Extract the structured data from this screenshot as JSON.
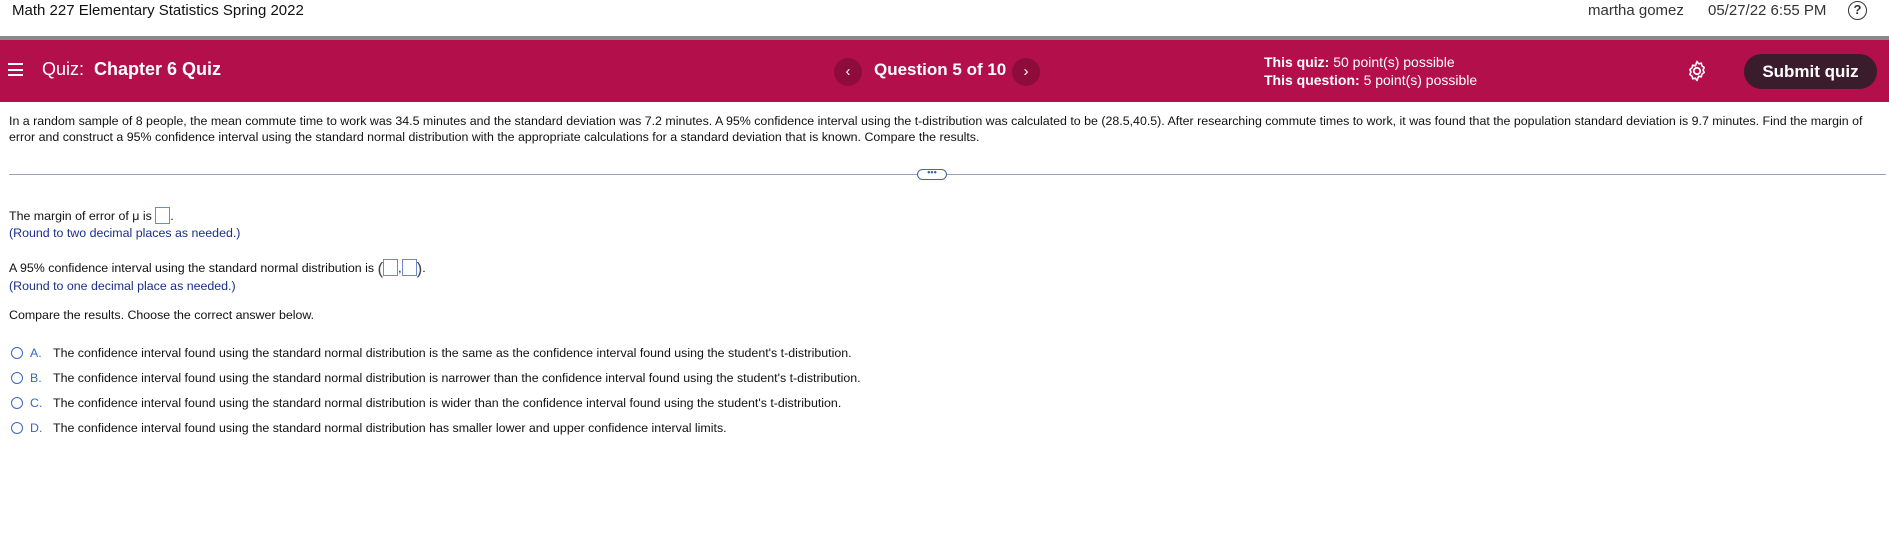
{
  "topbar": {
    "course_title": "Math 227 Elementary Statistics Spring 2022",
    "user_name": "martha gomez",
    "datetime": "05/27/22 6:55 PM",
    "help_symbol": "?"
  },
  "quizbar": {
    "quiz_label": "Quiz:",
    "quiz_name": "Chapter 6 Quiz",
    "question_label": "Question 5 of 10",
    "prev_symbol": "‹",
    "next_symbol": "›",
    "this_quiz_label": "This quiz:",
    "this_quiz_value": "50 point(s) possible",
    "this_question_label": "This question:",
    "this_question_value": "5 point(s) possible",
    "submit_label": "Submit quiz",
    "bg_color": "#b30f4a"
  },
  "question": {
    "problem_text": "In a random sample of 8 people, the mean commute time to work was 34.5 minutes and the standard deviation was 7.2 minutes. A 95% confidence interval using the t-distribution was calculated to be (28.5,40.5). After researching commute times to work, it was found that the population standard deviation is 9.7 minutes. Find the margin of error and construct a 95% confidence interval using the standard normal distribution with the appropriate calculations for a standard deviation that is known. Compare the results.",
    "expand_symbol": "•••",
    "margin_prompt": "The margin of error of μ is",
    "margin_value": "",
    "margin_hint": "(Round to two decimal places as needed.)",
    "ci_prompt": "A 95% confidence interval using the standard normal distribution is",
    "ci_lower": "",
    "ci_upper": "",
    "ci_hint": "(Round to one decimal place as needed.)",
    "compare_prompt": "Compare the results. Choose the correct answer below.",
    "options": [
      {
        "letter": "A.",
        "text": "The confidence interval found using the standard normal distribution is the same as the confidence interval found using the student's t-distribution."
      },
      {
        "letter": "B.",
        "text": "The confidence interval found using the standard normal distribution is narrower than the confidence interval found using the student's t-distribution."
      },
      {
        "letter": "C.",
        "text": "The confidence interval found using the standard normal distribution is wider than the confidence interval found using the student's t-distribution."
      },
      {
        "letter": "D.",
        "text": "The confidence interval found using the standard normal distribution has smaller lower and upper confidence interval limits."
      }
    ]
  }
}
